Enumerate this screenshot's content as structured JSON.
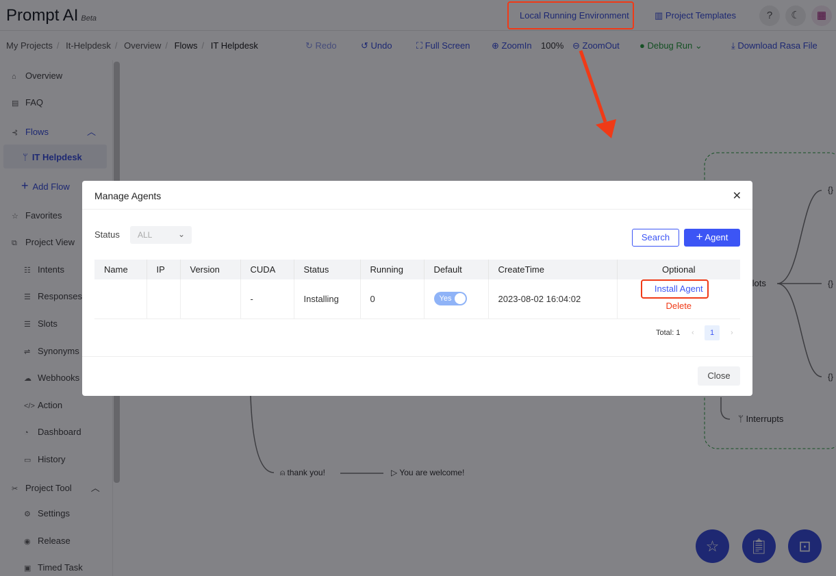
{
  "header": {
    "logo": "Prompt AI",
    "logo_badge": "Beta",
    "local_env": "Local Running Environment",
    "templates": "Project Templates",
    "help": "?"
  },
  "breadcrumb": [
    "My Projects",
    "It-Helpdesk",
    "Overview",
    "Flows",
    "IT Helpdesk"
  ],
  "toolbar": {
    "redo": "Redo",
    "undo": "Undo",
    "fullscreen": "Full Screen",
    "zoomin": "ZoomIn",
    "zoom": "100%",
    "zoomout": "ZoomOut",
    "debug": "Debug Run",
    "download": "Download Rasa File"
  },
  "sidebar": {
    "overview": "Overview",
    "faq": "FAQ",
    "flows": "Flows",
    "it_helpdesk": "IT Helpdesk",
    "add_flow": "Add Flow",
    "favorites": "Favorites",
    "project_view": "Project View",
    "intents": "Intents",
    "responses": "Responses",
    "slots": "Slots",
    "synonyms": "Synonyms",
    "webhooks": "Webhooks",
    "action": "Action",
    "dashboard": "Dashboard",
    "history": "History",
    "project_tool": "Project Tool",
    "settings": "Settings",
    "release": "Release",
    "timed_task": "Timed Task"
  },
  "canvas": {
    "slots": "Slots",
    "interrupts": "Interrupts",
    "user_msg": "thank you!",
    "bot_msg": "You are welcome!",
    "brace": "{}"
  },
  "modal": {
    "title": "Manage Agents",
    "status_label": "Status",
    "status_value": "ALL",
    "search": "Search",
    "add_agent": "Agent",
    "columns": [
      "Name",
      "IP",
      "Version",
      "CUDA",
      "Status",
      "Running",
      "Default",
      "CreateTime",
      "Optional"
    ],
    "row": {
      "name": "",
      "ip": "",
      "version": "",
      "cuda": "-",
      "status": "Installing",
      "running": "0",
      "default": "Yes",
      "create_time": "2023-08-02 16:04:02",
      "install": "Install Agent",
      "delete": "Delete"
    },
    "total": "Total: 1",
    "page": "1",
    "close": "Close"
  },
  "colors": {
    "accent": "#3c55f5",
    "danger": "#f03a17",
    "success": "#2a9d3f"
  }
}
